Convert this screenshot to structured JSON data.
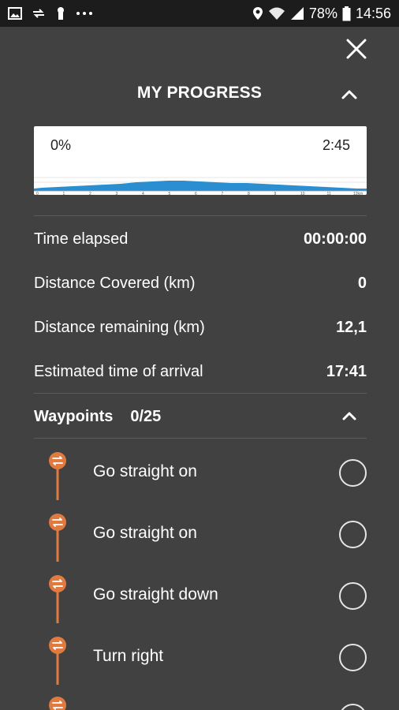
{
  "status_bar": {
    "battery": "78%",
    "time": "14:56",
    "icons": [
      "image-icon",
      "sync-icon",
      "keyhole-icon",
      "more-dots-icon",
      "location-icon",
      "wifi-icon",
      "signal-icon",
      "battery-icon"
    ]
  },
  "panel": {
    "title": "MY PROGRESS"
  },
  "progress": {
    "percent_text": "0%",
    "time_text": "2:45",
    "percent_value": 0,
    "profile_color": "#2a8fd0",
    "axis_ticks": [
      "0",
      "1",
      "2",
      "3",
      "4",
      "5",
      "6",
      "7",
      "8",
      "9",
      "10",
      "11",
      "12km"
    ]
  },
  "stats": [
    {
      "label": "Time elapsed",
      "value": "00:00:00"
    },
    {
      "label": "Distance Covered (km)",
      "value": "0"
    },
    {
      "label": "Distance remaining (km)",
      "value": "12,1"
    },
    {
      "label": "Estimated time of arrival",
      "value": "17:41"
    }
  ],
  "waypoints": {
    "title": "Waypoints",
    "count": "0/25",
    "pin_color": "#e07a3f",
    "items": [
      {
        "label": "Go straight on"
      },
      {
        "label": "Go straight on"
      },
      {
        "label": "Go straight down"
      },
      {
        "label": "Turn right"
      }
    ]
  }
}
